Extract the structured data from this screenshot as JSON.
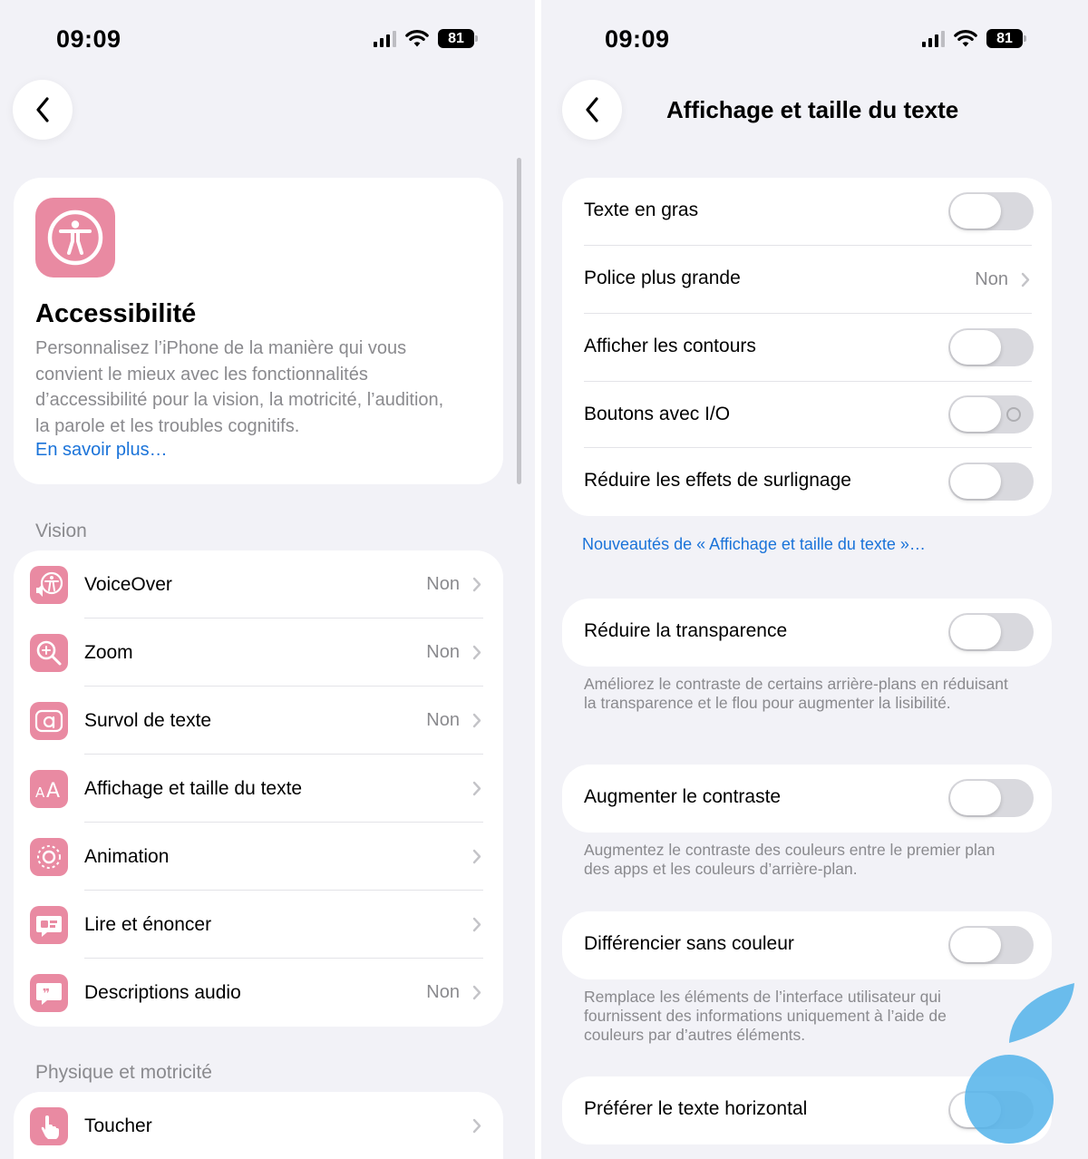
{
  "left": {
    "status": {
      "time": "09:09",
      "battery": "81"
    },
    "hero": {
      "title": "Accessibilité",
      "description": "Personnalisez l’iPhone de la manière qui vous convient le mieux avec les fonctionnalités d’accessibilité pour la vision, la motricité, l’audition, la parole et les troubles cognitifs.",
      "link": "En savoir plus…"
    },
    "sections": {
      "vision": "Vision",
      "physique": "Physique et motricité"
    },
    "vision_items": [
      {
        "label": "VoiceOver",
        "value": "Non",
        "icon": "voiceover-icon"
      },
      {
        "label": "Zoom",
        "value": "Non",
        "icon": "zoom-icon"
      },
      {
        "label": "Survol de texte",
        "value": "Non",
        "icon": "hover-text-icon"
      },
      {
        "label": "Affichage et taille du texte",
        "value": "",
        "icon": "text-size-icon"
      },
      {
        "label": "Animation",
        "value": "",
        "icon": "animation-icon"
      },
      {
        "label": "Lire et énoncer",
        "value": "",
        "icon": "speak-icon"
      },
      {
        "label": "Descriptions audio",
        "value": "Non",
        "icon": "audio-description-icon"
      }
    ],
    "physique_items": [
      {
        "label": "Toucher",
        "value": "",
        "icon": "touch-icon"
      }
    ]
  },
  "right": {
    "status": {
      "time": "09:09",
      "battery": "81"
    },
    "title": "Affichage et taille du texte",
    "group1": [
      {
        "label": "Texte en gras",
        "type": "toggle",
        "on": false
      },
      {
        "label": "Police plus grande",
        "type": "link",
        "value": "Non"
      },
      {
        "label": "Afficher les contours",
        "type": "toggle",
        "on": false
      },
      {
        "label": "Boutons avec I/O",
        "type": "toggle",
        "on": false
      },
      {
        "label": "Réduire les effets de surlignage",
        "type": "toggle",
        "on": false
      }
    ],
    "whats_new_link": "Nouveautés de « Affichage et taille du texte »…",
    "reduce_transparency": {
      "label": "Réduire la transparence",
      "note": "Améliorez le contraste de certains arrière-plans en réduisant la transparence et le flou pour augmenter la lisibilité."
    },
    "increase_contrast": {
      "label": "Augmenter le contraste",
      "note": "Augmentez le contraste des couleurs entre le premier plan des apps et les couleurs d’arrière-plan."
    },
    "differentiate": {
      "label": "Différencier sans couleur",
      "note": "Remplace les éléments de l’interface utilisateur qui fournissent des informations uniquement à l’aide de couleurs par d’autres éléments."
    },
    "horizontal_text": {
      "label": "Préférer le texte horizontal"
    }
  },
  "colors": {
    "accent_pink": "#e98aa2",
    "link_blue": "#1a73d9",
    "overlay_blue": "#52b3ea"
  }
}
